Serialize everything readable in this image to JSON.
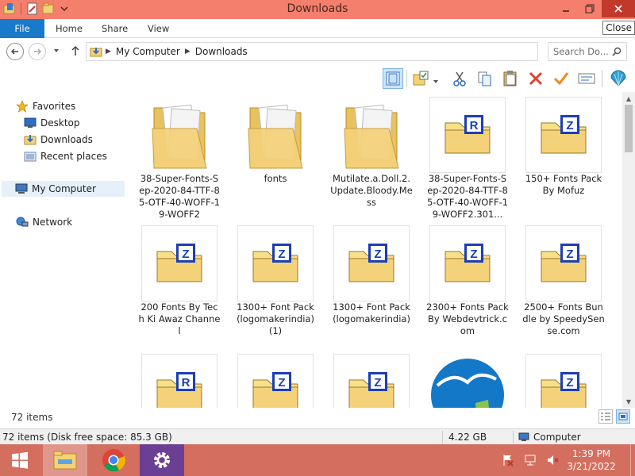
{
  "window": {
    "title": "Downloads",
    "close_tooltip": "Close"
  },
  "ribbon": {
    "tabs": [
      {
        "label": "File"
      },
      {
        "label": "Home"
      },
      {
        "label": "Share"
      },
      {
        "label": "View"
      }
    ]
  },
  "address": {
    "crumbs": [
      "My Computer",
      "Downloads"
    ],
    "search_placeholder": "Search Do..."
  },
  "navpane": {
    "favorites": "Favorites",
    "desktop": "Desktop",
    "downloads": "Downloads",
    "recent": "Recent places",
    "computer": "My Computer",
    "network": "Network"
  },
  "files": [
    {
      "name": "38-Super-Fonts-Sep-2020-84-TTF-85-OTF-40-WOFF-19-WOFF2",
      "kind": "folder-docs"
    },
    {
      "name": "fonts",
      "kind": "folder-docs"
    },
    {
      "name": "Mutilate.a.Doll.2.Update.Bloody.Mess",
      "kind": "folder-docs"
    },
    {
      "name": "38-Super-Fonts-Sep-2020-84-TTF-85-OTF-40-WOFF-19-WOFF2.301...",
      "kind": "rar"
    },
    {
      "name": "150+ Fonts Pack By Mofuz",
      "kind": "zip"
    },
    {
      "name": "200 Fonts By Tech Ki Awaz Channel",
      "kind": "zip"
    },
    {
      "name": "1300+ Font Pack (logomakerindia) (1)",
      "kind": "zip"
    },
    {
      "name": "1300+ Font Pack (logomakerindia)",
      "kind": "zip"
    },
    {
      "name": "2300+ Fonts Pack By Webdevtrick.com",
      "kind": "zip"
    },
    {
      "name": "2500+ Fonts Bundle by SpeedySense.com",
      "kind": "zip"
    },
    {
      "name": "",
      "kind": "rar"
    },
    {
      "name": "",
      "kind": "zip"
    },
    {
      "name": "",
      "kind": "zip"
    },
    {
      "name": "",
      "kind": "openoffice"
    },
    {
      "name": "",
      "kind": "zip"
    }
  ],
  "footer": {
    "item_count": "72 items"
  },
  "statusbar": {
    "summary": "72 items (Disk free space: 85.3 GB)",
    "size": "4.22 GB",
    "location": "Computer"
  },
  "taskbar": {
    "time": "1:39 PM",
    "date": "3/21/2022"
  },
  "colors": {
    "titlebar": "#f47f6d",
    "file_tab": "#1979ca",
    "taskbar": "#d46e5e"
  }
}
